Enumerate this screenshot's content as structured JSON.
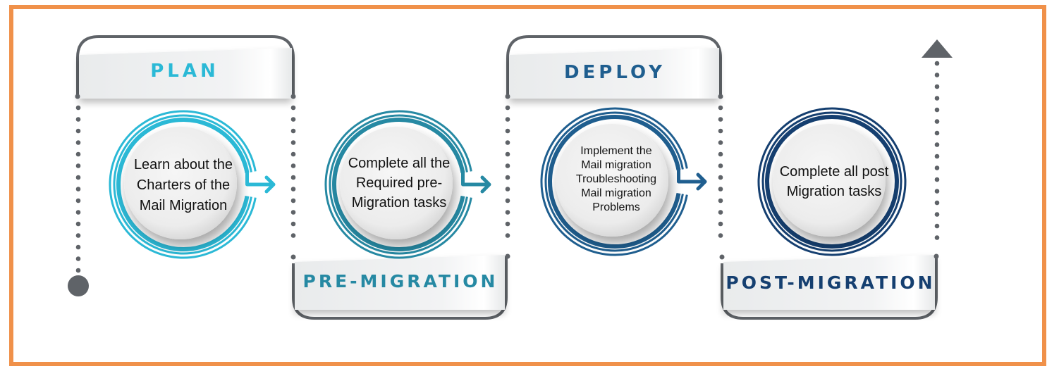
{
  "colors": {
    "frame": "#F0914A",
    "line_gray": "#5F6368",
    "plan": "#2BB9D6",
    "pre_migration": "#2689A3",
    "deploy": "#1F5E8F",
    "post_migration": "#153F70"
  },
  "stages": [
    {
      "label": "PLAN",
      "text": "Learn about the Charters of the Mail Migration",
      "lines": [
        "Learn about the",
        "Charters of the",
        "Mail Migration"
      ],
      "position": "top"
    },
    {
      "label": "PRE-MIGRATION",
      "text": "Complete all the Required pre-Migration tasks",
      "lines": [
        "Complete all the",
        "Required pre-",
        "Migration tasks"
      ],
      "position": "bottom"
    },
    {
      "label": "DEPLOY",
      "text": "Implement the Mail migration Troubleshooting Mail migration Problems",
      "lines": [
        "Implement the",
        "Mail migration",
        "Troubleshooting",
        "Mail migration",
        "Problems"
      ],
      "position": "top"
    },
    {
      "label": "POST-MIGRATION",
      "text": "Complete all post Migration tasks",
      "lines": [
        "Complete all post",
        "Migration tasks"
      ],
      "position": "bottom"
    }
  ],
  "icons": {
    "start": "start-dot-icon",
    "end": "up-arrow-icon",
    "connector": "right-arrow-icon"
  }
}
